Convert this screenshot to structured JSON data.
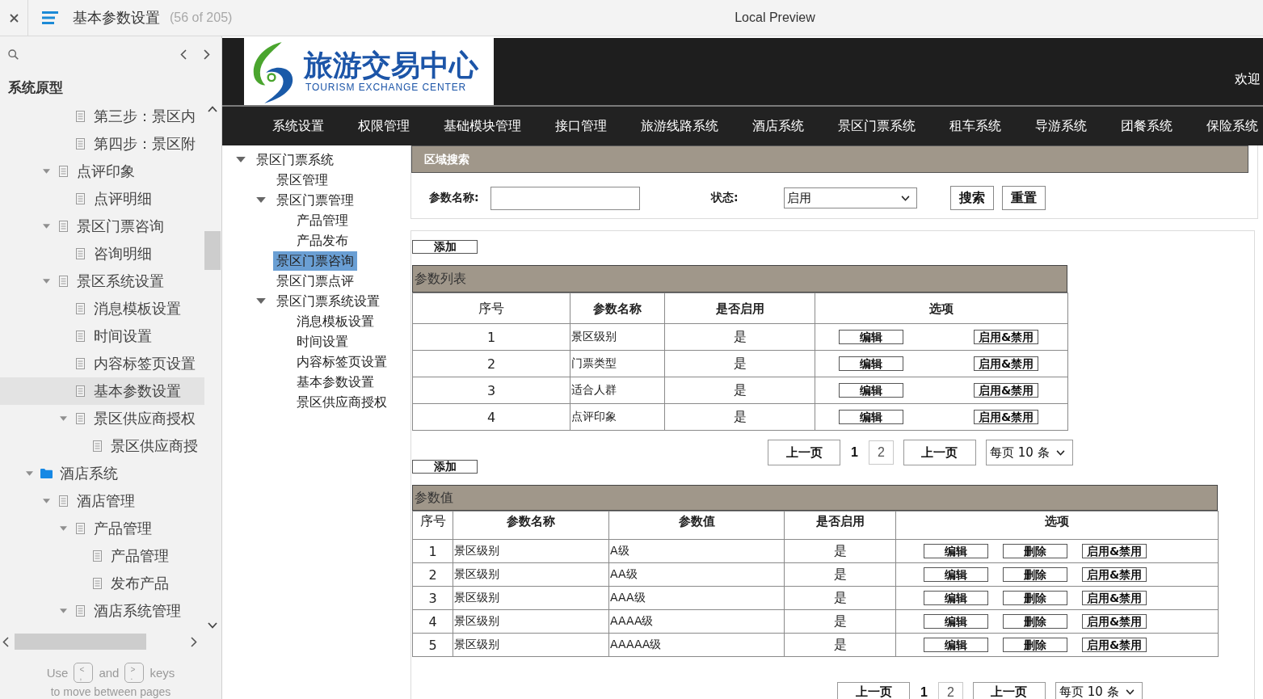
{
  "window": {
    "title": "基本参数设置",
    "page_count": "(56 of 205)",
    "preview_label": "Local Preview"
  },
  "sidebar": {
    "heading": "系统原型",
    "tree": [
      {
        "children": [
          {
            "children": [
              {
                "label": "第三步：景区内",
                "kind": "page",
                "selected": false
              },
              {
                "label": "第四步：景区附",
                "kind": "page",
                "selected": false
              }
            ]
          },
          {
            "label": "点评印象",
            "kind": "page",
            "selected": false,
            "expanded": true,
            "children": [
              {
                "label": "点评明细",
                "kind": "page",
                "selected": false
              }
            ]
          },
          {
            "label": "景区门票咨询",
            "kind": "page",
            "selected": false,
            "expanded": true,
            "children": [
              {
                "label": "咨询明细",
                "kind": "page",
                "selected": false
              }
            ]
          },
          {
            "label": "景区系统设置",
            "kind": "page",
            "selected": false,
            "expanded": true,
            "children": [
              {
                "label": "消息模板设置",
                "kind": "page",
                "selected": false
              },
              {
                "label": "时间设置",
                "kind": "page",
                "selected": false
              },
              {
                "label": "内容标签页设置",
                "kind": "page",
                "selected": false
              },
              {
                "label": "基本参数设置",
                "kind": "page",
                "selected": true
              },
              {
                "label": "景区供应商授权",
                "kind": "page",
                "selected": false,
                "expanded": true,
                "children": [
                  {
                    "label": "景区供应商授",
                    "kind": "page",
                    "selected": false
                  }
                ]
              }
            ]
          }
        ]
      },
      {
        "label": "酒店系统",
        "kind": "folder",
        "selected": false,
        "expanded": true,
        "children": [
          {
            "label": "酒店管理",
            "kind": "page",
            "selected": false,
            "expanded": true,
            "children": [
              {
                "label": "产品管理",
                "kind": "page",
                "selected": false,
                "expanded": true,
                "children": [
                  {
                    "label": "产品管理",
                    "kind": "page",
                    "selected": false
                  },
                  {
                    "label": "发布产品",
                    "kind": "page",
                    "selected": false
                  }
                ]
              },
              {
                "label": "酒店系统管理",
                "kind": "page",
                "selected": false,
                "expanded": true
              }
            ]
          }
        ]
      }
    ],
    "footer": {
      "before": "Use",
      "prev_key": {
        "main": "<",
        "alt": ","
      },
      "between": "and",
      "next_key": {
        "main": ">",
        "alt": "."
      },
      "after": "keys",
      "hint": "to move between pages"
    }
  },
  "prototype": {
    "logo": {
      "name_cn": "旅游交易中心",
      "name_en": "TOURISM EXCHANGE CENTER"
    },
    "welcome": "欢迎",
    "nav": [
      "系统设置",
      "权限管理",
      "基础模块管理",
      "接口管理",
      "旅游线路系统",
      "酒店系统",
      "景区门票系统",
      "租车系统",
      "导游系统",
      "团餐系统",
      "保险系统"
    ],
    "tree": [
      {
        "label": "景区门票系统",
        "selected": false,
        "expanded": true,
        "children": [
          {
            "label": "景区管理",
            "selected": false
          },
          {
            "label": "景区门票管理",
            "selected": false,
            "expanded": true,
            "children": [
              {
                "label": "产品管理",
                "selected": false
              },
              {
                "label": "产品发布",
                "selected": false
              }
            ]
          },
          {
            "label": "景区门票咨询",
            "selected": true
          },
          {
            "label": "景区门票点评",
            "selected": false
          },
          {
            "label": "景区门票系统设置",
            "selected": false,
            "expanded": true,
            "children": [
              {
                "label": "消息模板设置",
                "selected": false
              },
              {
                "label": "时间设置",
                "selected": false
              },
              {
                "label": "内容标签页设置",
                "selected": false
              },
              {
                "label": "基本参数设置",
                "selected": false
              },
              {
                "label": "景区供应商授权",
                "selected": false
              }
            ]
          }
        ]
      }
    ],
    "search": {
      "title": "区域搜索",
      "fields": [
        {
          "kind": "text",
          "label": "参数名称:"
        },
        {
          "kind": "select",
          "label": "状态:",
          "value": "启用"
        }
      ],
      "buttons": [
        "搜索",
        "重置"
      ]
    },
    "param_list": {
      "add_button": "添加",
      "title": "参数列表",
      "columns": [
        {
          "label": "序号",
          "kind": "number"
        },
        {
          "label": "参数名称",
          "kind": "text"
        },
        {
          "label": "是否启用",
          "kind": "flag"
        },
        {
          "label": "选项",
          "kind": "actions"
        }
      ],
      "rows": [
        {
          "cells": [
            "1",
            "景区级别",
            "是"
          ],
          "actions": [
            "编辑",
            "启用&禁用"
          ]
        },
        {
          "cells": [
            "2",
            "门票类型",
            "是"
          ],
          "actions": [
            "编辑",
            "启用&禁用"
          ]
        },
        {
          "cells": [
            "3",
            "适合人群",
            "是"
          ],
          "actions": [
            "编辑",
            "启用&禁用"
          ]
        },
        {
          "cells": [
            "4",
            "点评印象",
            "是"
          ],
          "actions": [
            "编辑",
            "启用&禁用"
          ]
        }
      ],
      "pagination": {
        "prev": "上一页",
        "pages": [
          {
            "label": "1",
            "selected": true
          },
          {
            "label": "2",
            "selected": false
          }
        ],
        "next": "上一页",
        "page_size": "每页 10 条"
      }
    },
    "param_values": {
      "add_button": "添加",
      "title": "参数值",
      "columns": [
        {
          "label": "序号",
          "kind": "number"
        },
        {
          "label": "参数名称",
          "kind": "text"
        },
        {
          "label": "参数值",
          "kind": "text"
        },
        {
          "label": "是否启用",
          "kind": "flag"
        },
        {
          "label": "选项",
          "kind": "actions"
        }
      ],
      "rows": [
        {
          "cells": [
            "1",
            "景区级别",
            "A级",
            "是"
          ],
          "actions": [
            "编辑",
            "删除",
            "启用&禁用"
          ]
        },
        {
          "cells": [
            "2",
            "景区级别",
            "AA级",
            "是"
          ],
          "actions": [
            "编辑",
            "删除",
            "启用&禁用"
          ]
        },
        {
          "cells": [
            "3",
            "景区级别",
            "AAA级",
            "是"
          ],
          "actions": [
            "编辑",
            "删除",
            "启用&禁用"
          ]
        },
        {
          "cells": [
            "4",
            "景区级别",
            "AAAA级",
            "是"
          ],
          "actions": [
            "编辑",
            "删除",
            "启用&禁用"
          ]
        },
        {
          "cells": [
            "5",
            "景区级别",
            "AAAAA级",
            "是"
          ],
          "actions": [
            "编辑",
            "删除",
            "启用&禁用"
          ]
        }
      ],
      "pagination": {
        "prev": "上一页",
        "pages": [
          {
            "label": "1",
            "selected": true
          },
          {
            "label": "2",
            "selected": false
          }
        ],
        "next": "上一页",
        "page_size": "每页 10 条"
      }
    }
  }
}
